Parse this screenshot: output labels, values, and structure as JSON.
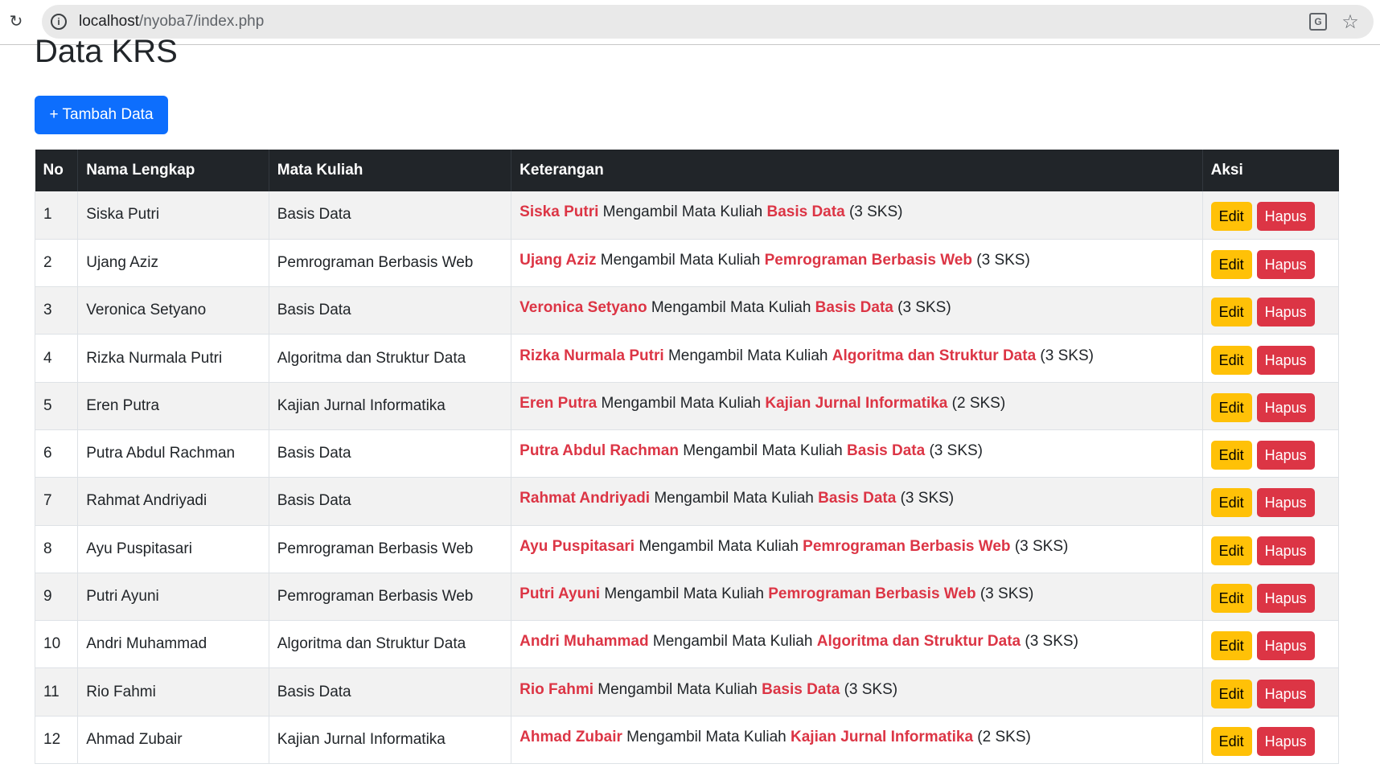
{
  "browser": {
    "url_host": "localhost",
    "url_path": "/nyoba7/index.php",
    "reload_icon": "reload-icon",
    "info_icon": "info-icon",
    "translate_icon": "translate-icon",
    "star_icon": "star-icon"
  },
  "page": {
    "title": "Data KRS",
    "add_button_label": "+ Tambah Data"
  },
  "table": {
    "headers": [
      "No",
      "Nama Lengkap",
      "Mata Kuliah",
      "Keterangan",
      "Aksi"
    ],
    "desc_connector": "Mengambil Mata Kuliah",
    "edit_label": "Edit",
    "delete_label": "Hapus",
    "rows": [
      {
        "no": "1",
        "nama": "Siska Putri",
        "matkul": "Basis Data",
        "sks": "(3 SKS)"
      },
      {
        "no": "2",
        "nama": "Ujang Aziz",
        "matkul": "Pemrograman Berbasis Web",
        "sks": "(3 SKS)"
      },
      {
        "no": "3",
        "nama": "Veronica Setyano",
        "matkul": "Basis Data",
        "sks": "(3 SKS)"
      },
      {
        "no": "4",
        "nama": "Rizka Nurmala Putri",
        "matkul": "Algoritma dan Struktur Data",
        "sks": "(3 SKS)"
      },
      {
        "no": "5",
        "nama": "Eren Putra",
        "matkul": "Kajian Jurnal Informatika",
        "sks": "(2 SKS)"
      },
      {
        "no": "6",
        "nama": "Putra Abdul Rachman",
        "matkul": "Basis Data",
        "sks": "(3 SKS)"
      },
      {
        "no": "7",
        "nama": "Rahmat Andriyadi",
        "matkul": "Basis Data",
        "sks": "(3 SKS)"
      },
      {
        "no": "8",
        "nama": "Ayu Puspitasari",
        "matkul": "Pemrograman Berbasis Web",
        "sks": "(3 SKS)"
      },
      {
        "no": "9",
        "nama": "Putri Ayuni",
        "matkul": "Pemrograman Berbasis Web",
        "sks": "(3 SKS)"
      },
      {
        "no": "10",
        "nama": "Andri Muhammad",
        "matkul": "Algoritma dan Struktur Data",
        "sks": "(3 SKS)"
      },
      {
        "no": "11",
        "nama": "Rio Fahmi",
        "matkul": "Basis Data",
        "sks": "(3 SKS)"
      },
      {
        "no": "12",
        "nama": "Ahmad Zubair",
        "matkul": "Kajian Jurnal Informatika",
        "sks": "(2 SKS)"
      }
    ]
  },
  "colors": {
    "primary": "#0d6efd",
    "warning": "#ffc107",
    "danger": "#dc3545",
    "table_header": "#212529"
  }
}
